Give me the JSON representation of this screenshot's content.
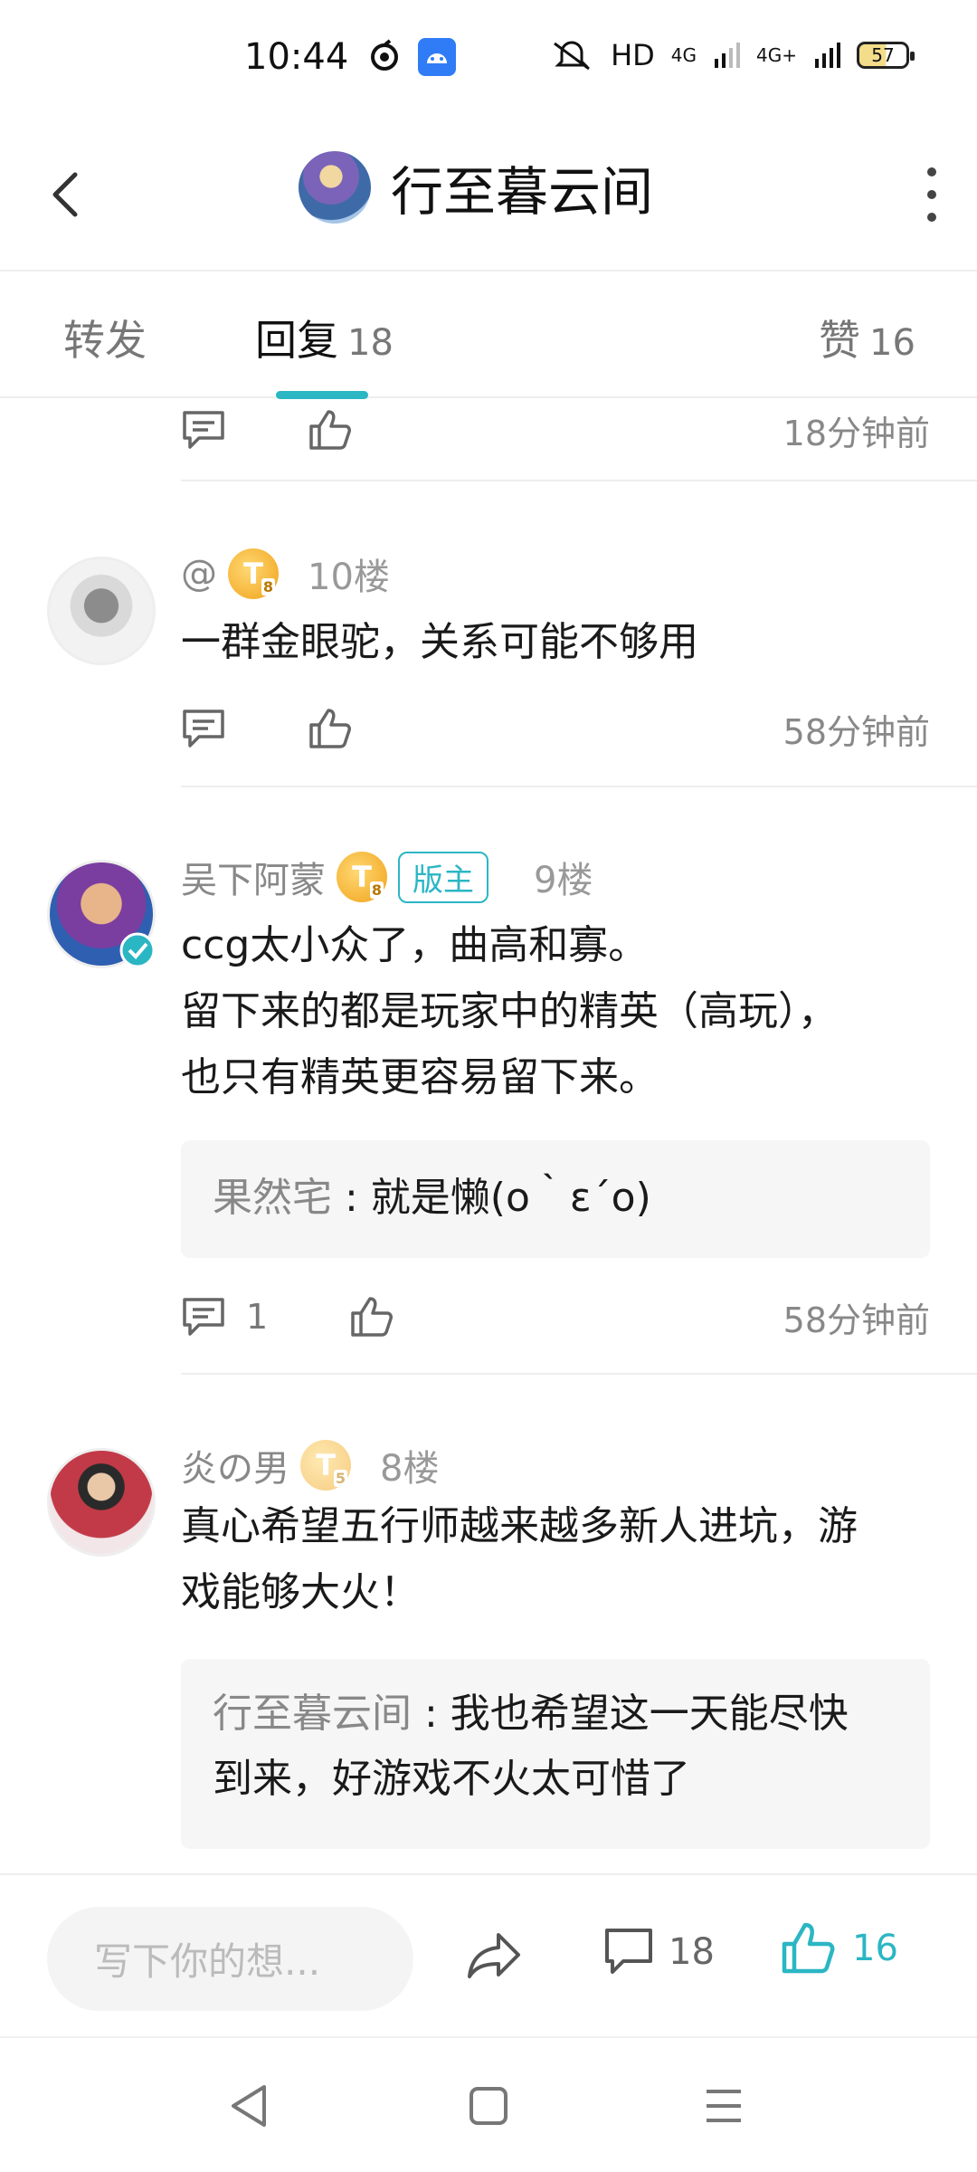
{
  "status_bar": {
    "time": "10:44",
    "network": "HD",
    "signal1": "4G",
    "signal2": "4G+",
    "battery": "57"
  },
  "header": {
    "title": "行至暮云间",
    "back_icon": "chevron-left-icon",
    "more_icon": "kebab-icon"
  },
  "tabs": [
    {
      "label": "转发",
      "count": ""
    },
    {
      "label": "回复",
      "count": "18"
    },
    {
      "label": "赞",
      "count": "16"
    }
  ],
  "colors": {
    "accent": "#2bb6c4",
    "badge": "#f0a21a"
  },
  "top_action": {
    "time": "18分钟前"
  },
  "comments": [
    {
      "user": "@",
      "level": "T",
      "level_num": "8",
      "floor": "10楼",
      "text": "一群金眼驼，关系可能不够用",
      "reply_count": "",
      "time": "58分钟前"
    },
    {
      "user": "吴下阿蒙",
      "level": "T",
      "level_num": "8",
      "role": "版主",
      "floor": "9楼",
      "lines": [
        "ccg太小众了，曲高和寡。",
        "留下来的都是玩家中的精英（高玩），",
        "也只有精英更容易留下来。"
      ],
      "reply": {
        "name": "果然宅",
        "text": "就是懒(o｀ε´o)"
      },
      "reply_count": "1",
      "time": "58分钟前"
    },
    {
      "user": "炎の男",
      "level": "T",
      "level_num": "5",
      "floor": "8楼",
      "lines": [
        "真心希望五行师越来越多新人进坑，游",
        "戏能够大火！"
      ],
      "reply": {
        "name": "行至暮云间",
        "line1": "我也希望这一天能尽快",
        "line2": "到来，好游戏不火太可惜了"
      }
    }
  ],
  "compose": {
    "placeholder": "写下你的想...",
    "comment_count": "18",
    "like_count": "16"
  }
}
